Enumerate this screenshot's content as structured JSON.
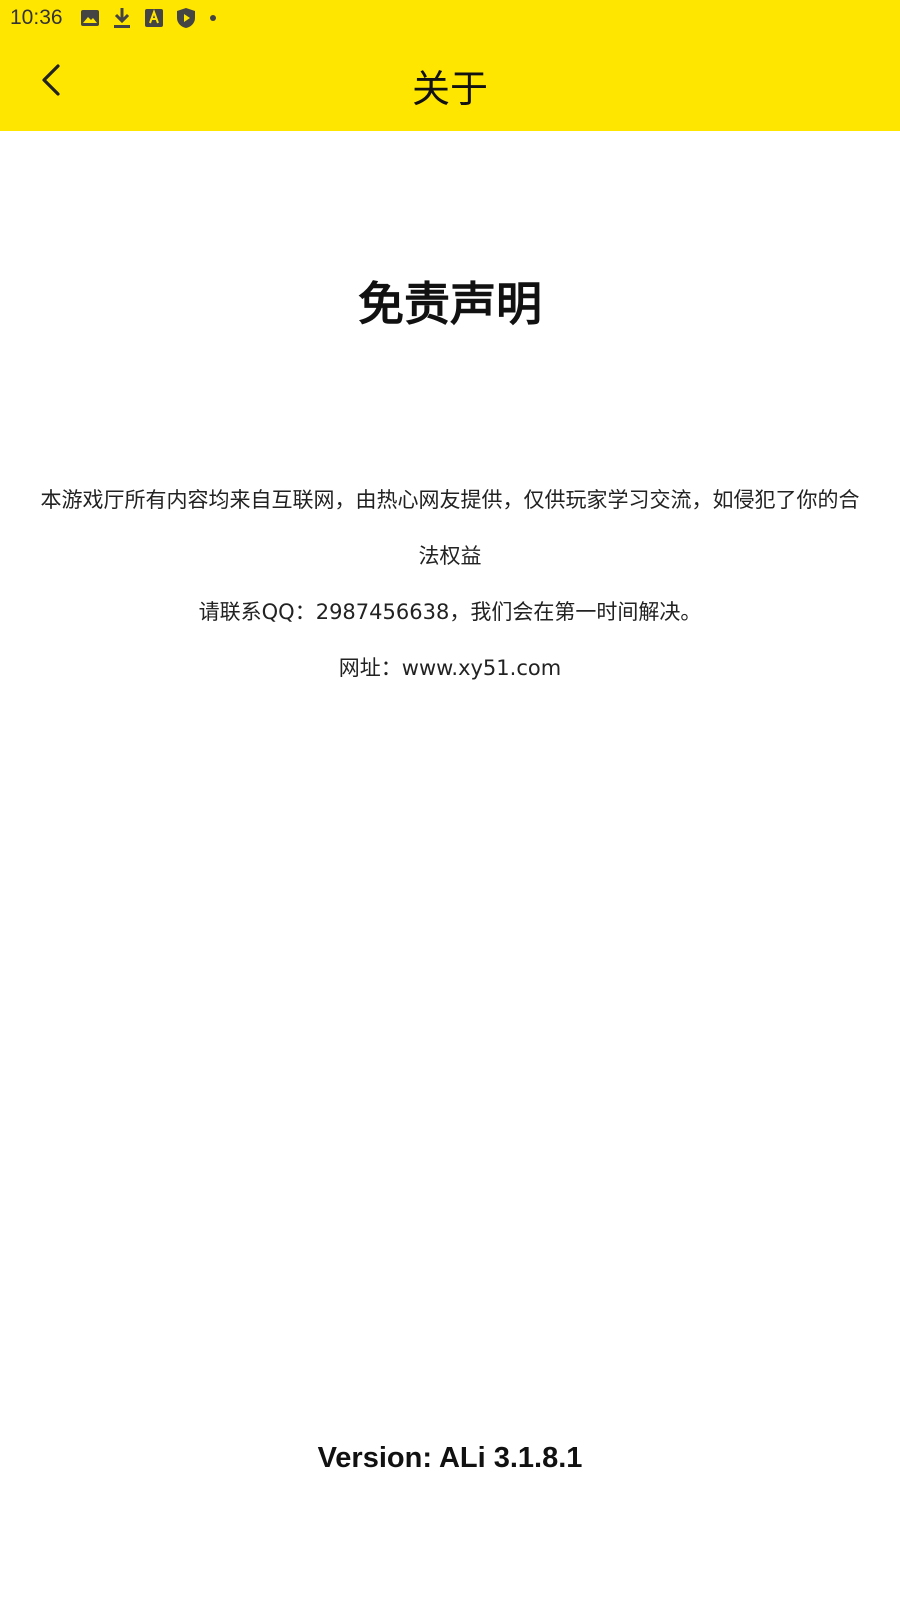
{
  "status_bar": {
    "time": "10:36",
    "icons": [
      "image-icon",
      "download-icon",
      "app-a-icon",
      "shield-play-icon",
      "dot-icon"
    ]
  },
  "header": {
    "title": "关于",
    "back_icon": "chevron-left-icon",
    "background_color": "#FFE600"
  },
  "content": {
    "heading": "免责声明",
    "line1": "本游戏厅所有内容均来自互联网，由热心网友提供，仅供玩家学习交流，如侵犯了你的合",
    "line2": "法权益",
    "contact": "请联系QQ：2987456638，我们会在第一时间解决。",
    "website": "网址：www.xy51.com"
  },
  "footer": {
    "version": "Version: ALi 3.1.8.1"
  }
}
